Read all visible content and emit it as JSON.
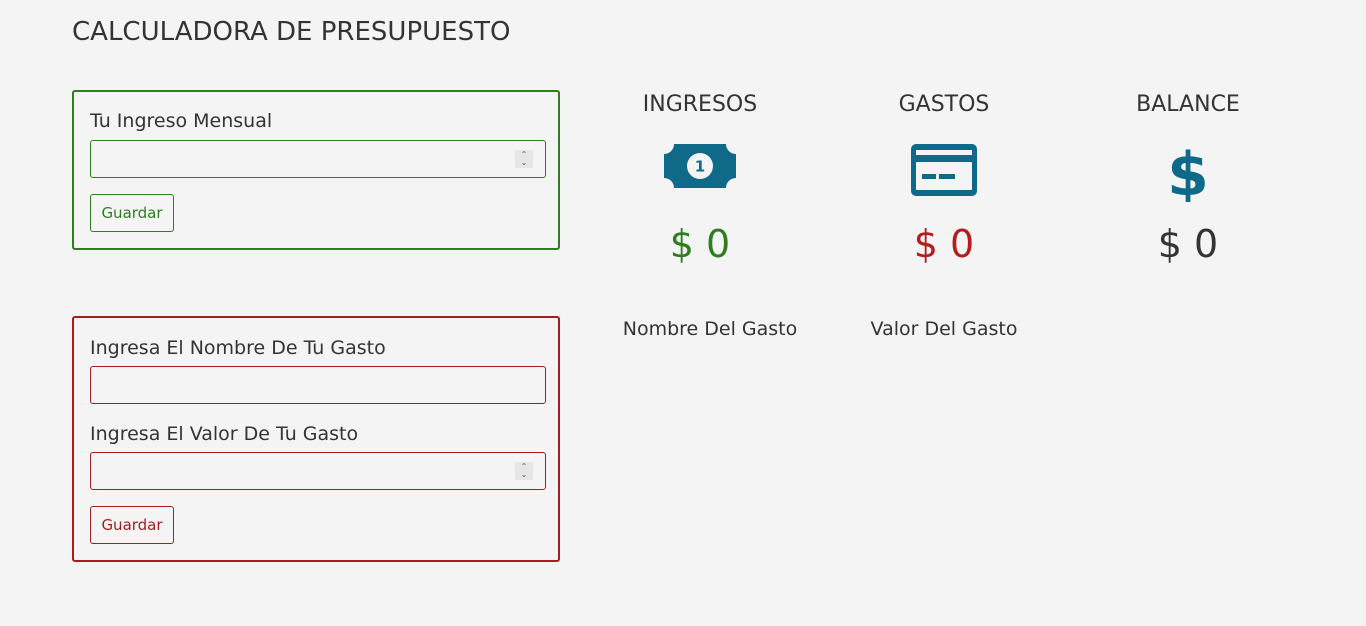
{
  "header": {
    "title": "CALCULADORA DE PRESUPUESTO"
  },
  "income_form": {
    "label": "Tu Ingreso Mensual",
    "value": "",
    "save_label": "Guardar"
  },
  "expense_form": {
    "name_label": "Ingresa El Nombre De Tu Gasto",
    "name_value": "",
    "amount_label": "Ingresa El Valor De Tu Gasto",
    "amount_value": "",
    "save_label": "Guardar"
  },
  "summary": {
    "income": {
      "title": "INGRESOS",
      "value": "$ 0",
      "icon": "money-bill-icon",
      "color": "#2e7d1f"
    },
    "expenses": {
      "title": "GASTOS",
      "value": "$ 0",
      "icon": "credit-card-icon",
      "color": "#b71c1c"
    },
    "balance": {
      "title": "BALANCE",
      "value": "$ 0",
      "icon": "dollar-sign-icon",
      "color": "#333333"
    }
  },
  "expense_table": {
    "columns": [
      "Nombre Del Gasto",
      "Valor Del Gasto"
    ]
  },
  "colors": {
    "background": "#f4f4f4",
    "income_accent": "#2e7d1f",
    "expense_accent": "#a51d1d",
    "icon_color": "#0f6a8a"
  }
}
